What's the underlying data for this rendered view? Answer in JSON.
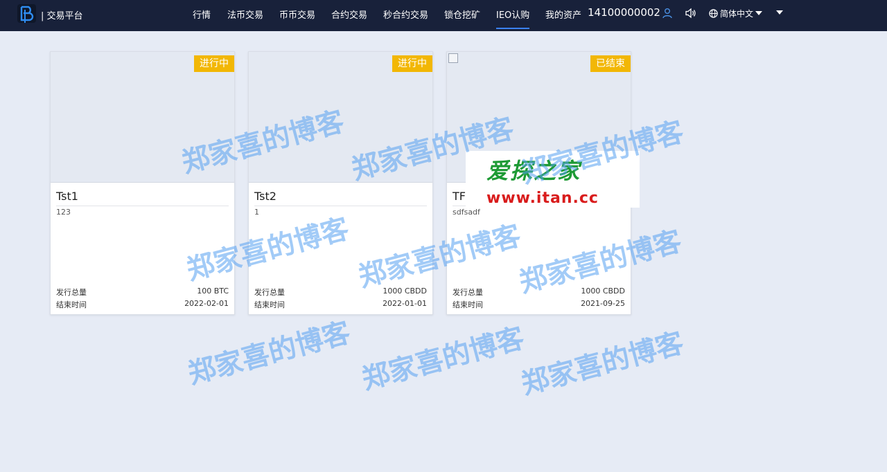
{
  "header": {
    "brand": "| 交易平台",
    "nav": [
      {
        "label": "行情",
        "active": false
      },
      {
        "label": "法币交易",
        "active": false
      },
      {
        "label": "币币交易",
        "active": false
      },
      {
        "label": "合约交易",
        "active": false
      },
      {
        "label": "秒合约交易",
        "active": false
      },
      {
        "label": "锁仓挖矿",
        "active": false
      },
      {
        "label": "IEO认购",
        "active": true
      },
      {
        "label": "我的资产",
        "active": false
      }
    ],
    "account": "14100000002",
    "language": "简体中文"
  },
  "cards": [
    {
      "badge": "进行中",
      "name": "Tst1",
      "desc": "123",
      "total_label": "发行总量",
      "total_value": "100 BTC",
      "end_label": "结束时间",
      "end_value": "2022-02-01"
    },
    {
      "badge": "进行中",
      "name": "Tst2",
      "desc": "1",
      "total_label": "发行总量",
      "total_value": "1000 CBDD",
      "end_label": "结束时间",
      "end_value": "2022-01-01"
    },
    {
      "badge": "已结束",
      "name": "TFI",
      "desc": "sdfsadf",
      "total_label": "发行总量",
      "total_value": "1000 CBDD",
      "end_label": "结束时间",
      "end_value": "2021-09-25"
    }
  ],
  "promo": {
    "line1": "爱探之家",
    "line2": "www.itan.cc"
  },
  "watermark": "郑家喜的博客",
  "colors": {
    "topbar": "#18213a",
    "badge": "#f2b705",
    "active_underline": "#3b82f6"
  }
}
